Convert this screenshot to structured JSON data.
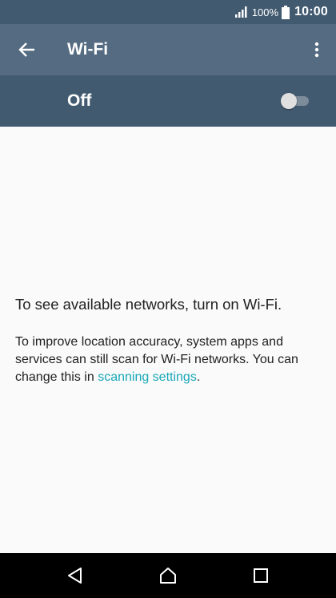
{
  "status_bar": {
    "battery_percent": "100%",
    "time": "10:00",
    "signal_icon": "signal-icon",
    "battery_icon": "battery-icon"
  },
  "app_bar": {
    "title": "Wi-Fi",
    "back_icon": "arrow-back-icon",
    "overflow_icon": "more-vertical-icon"
  },
  "wifi_switch": {
    "label": "Off",
    "state": false
  },
  "content": {
    "primary": "To see available networks, turn on Wi-Fi.",
    "secondary_prefix": "To improve location accuracy, system apps and services can still scan for Wi-Fi networks. You can change this in ",
    "link_text": "scanning settings",
    "secondary_suffix": "."
  },
  "nav_bar": {
    "back_icon": "nav-back-icon",
    "home_icon": "nav-home-icon",
    "recents_icon": "nav-recents-icon"
  },
  "colors": {
    "app_bar": "#546b81",
    "status_bar": "#425a70",
    "link": "#18a8b8",
    "background": "#fafafa"
  }
}
